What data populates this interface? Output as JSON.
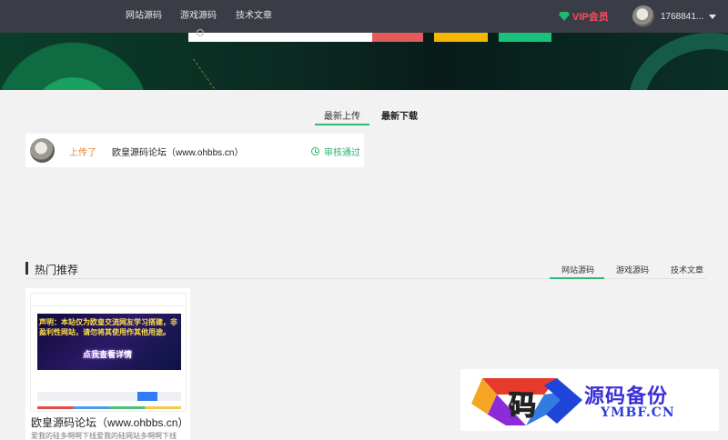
{
  "nav": {
    "links": [
      "网站源码",
      "游戏源码",
      "技术文章"
    ],
    "vip_label": "VIP会员",
    "user_name": "1768841..."
  },
  "upload_tabs": [
    "最新上传",
    "最新下载"
  ],
  "upload_item": {
    "action": "上传了",
    "title": "欧皇源码论坛（www.ohbbs.cn）",
    "status": "审核通过"
  },
  "hot": {
    "title": "热门推荐",
    "categories": [
      "网站源码",
      "游戏源码",
      "技术文章"
    ],
    "product": {
      "notice": "声明：本站仅为欧皇交流网友学习搭建，非盈利性网站，请勿将其使用作其他用途。",
      "cta": "点我查看详情",
      "title": "欧皇源码论坛（www.ohbbs.cn）",
      "description": "爱我的硅多啊啊下线爱我的硅网站多啊啊下线"
    }
  },
  "watermark": {
    "glyph": "码",
    "cn": "源码备份",
    "en": "YMBF.CN"
  },
  "colors": {
    "accent_green": "#2bbd76",
    "vip_red": "#ff4d5a",
    "topbar": "#3a3d45"
  }
}
